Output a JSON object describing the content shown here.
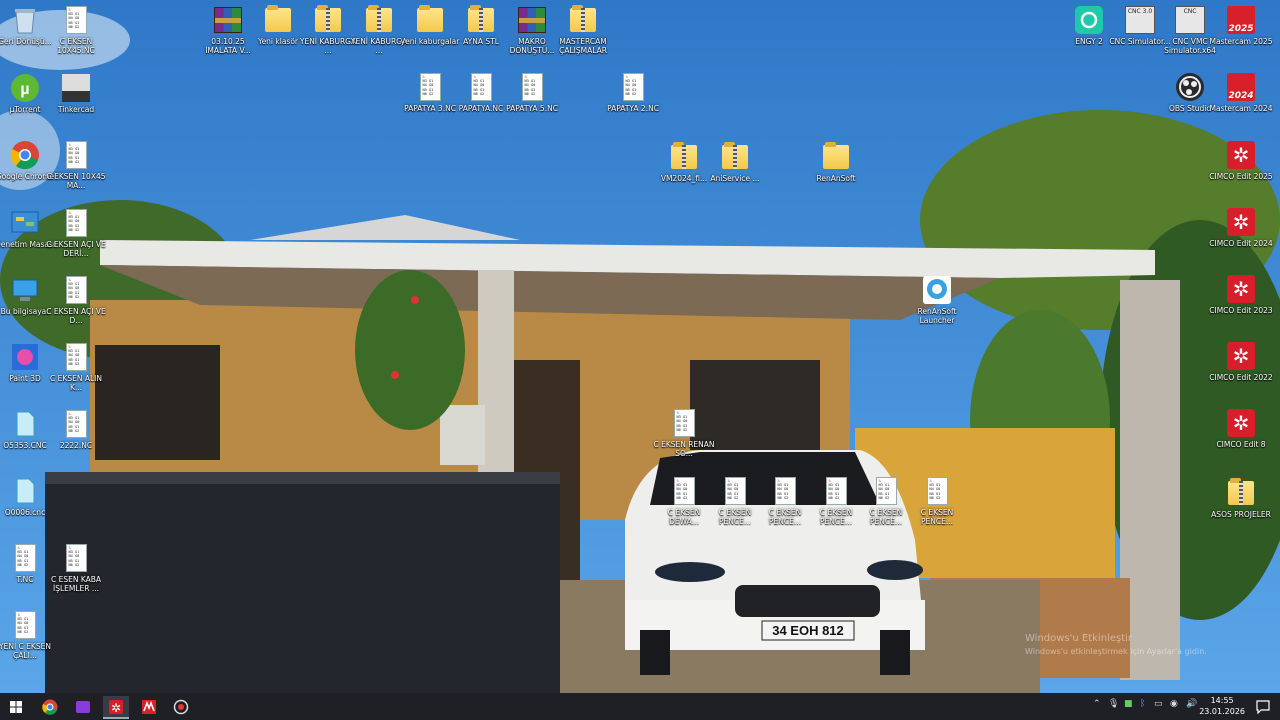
{
  "desktop": {
    "recycle_bin": "Geri Dönüşü...",
    "c_eksen_10x45": "C EKSEN 10X45.NC",
    "utorrent": "µTorrent",
    "tinkercad": "Tinkercad",
    "chrome": "Google Chrome",
    "c_eksen_10x45_ma": "C EKSEN 10X45 MA...",
    "denetim": "Denetim Masası",
    "c_eksen_aci_deri": "C EKSEN AÇI VE DERİ...",
    "bu_bilgisayar": "Bu bilgisayar",
    "c_eksen_aci_ve_d": "C EKSEN AÇI VE D...",
    "paint3d": "Paint 3D",
    "c_eksen_alin": "C EKSEN ALIN K...",
    "o5353": "O5353.CNC",
    "f2222": "2222.NC",
    "o0006": "O0006.cnc",
    "t_nc": "T.NC",
    "c_esen_kaba": "C ESEN KABA İŞLEMLER ...",
    "yeni_c_eksen": "YENİ C EKSEN ÇALI...",
    "imalata": "03.10.25 İMALATA V...",
    "yeni_klasor": "Yeni klasör",
    "yeni_kaburga1": "YENİ KABURGA ...",
    "yeni_kaburga2": "YENİ KABURGA ...",
    "yeni_kaburgalar": "yeni kaburgalar",
    "ayna_stl": "AYNA STL",
    "makro": "MAKRO DÖNÜŞTÜ...",
    "mastercam_calismalar": "MASTERCAM ÇALIŞMALAR",
    "papatya3": "PAPATYA 3.NC",
    "papatya": "PAPATYA.NC",
    "papatya5": "PAPATYA 5.NC",
    "papatya2": "PAPATYA 2.NC",
    "vm2024": "VM2024_fi...",
    "aniservice": "AniService ...",
    "renansoft": "RenAnSoft",
    "renansoft_launcher": "RenAnSoft Launcher",
    "c_eksen_renan": "C EKSEN RENAN SO...",
    "c_eksen_dewa": "C EKSEN DEWA...",
    "c_eksen_pence1": "C EKSEN PENCE...",
    "c_eksen_pence2": "C EKSEN PENCE...",
    "c_eksen_pence3": "C EKSEN PENCE...",
    "c_eksen_pence4": "C EKSEN PENCE...",
    "c_eksen_pence5": "C EKSEN PENCE...",
    "engy": "ENGY 2",
    "cnc_simulator": "CNC Simulator...",
    "cnc_vmc": "CNC VMC Simulator.x64",
    "mastercam2025": "Mastercam 2025",
    "obs": "OBS Studio",
    "mastercam2024": "Mastercam 2024",
    "cimco2025": "CIMCO Edit 2025",
    "cimco2024": "CIMCO Edit 2024",
    "cimco2023": "CIMCO Edit 2023",
    "cimco2022": "CIMCO Edit 2022",
    "cimco8": "CIMCO Edit 8",
    "asos": "ASOS PROJELER",
    "mc_year_2025": "2025",
    "mc_year_2024": "2024",
    "cnc_badge": "CNC 3.0",
    "cnc_badge2": "CNC",
    "license_plate": "34 EOH 812"
  },
  "watermark": {
    "line1": "Windows'u Etkinleştir",
    "line2": "Windows'u etkinleştirmek için Ayarlar'a gidin."
  },
  "taskbar": {
    "time": "14:55",
    "date": "23.01.2026"
  },
  "colors": {
    "sky": "#3a7fc4",
    "taskbar": "#1f1f26",
    "accent_red": "#d81e2a"
  }
}
